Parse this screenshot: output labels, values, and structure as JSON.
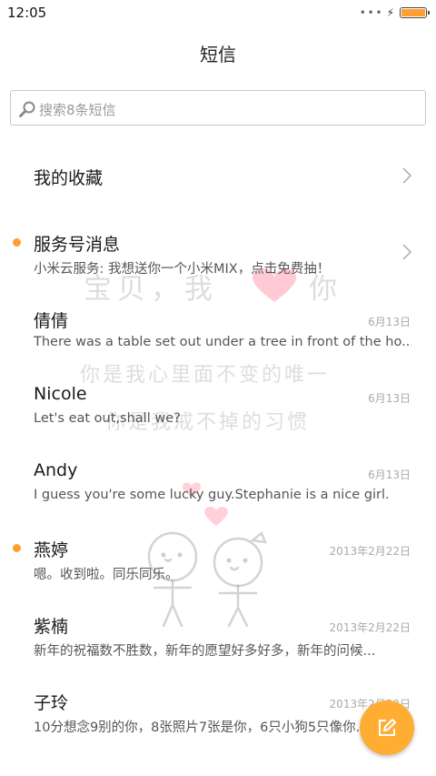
{
  "status_bar": {
    "time": "12:05",
    "battery_level": 1.0,
    "battery_color": "#ff9f2d"
  },
  "header": {
    "title": "短信"
  },
  "search": {
    "placeholder": "搜索8条短信"
  },
  "accent_color": "#ff9f2d",
  "items": [
    {
      "title": "我的收藏",
      "subtitle": "",
      "date": "",
      "unread": false,
      "has_chevron": true
    },
    {
      "title": "服务号消息",
      "subtitle": "小米云服务: 我想送你一个小米MIX，点击免费抽！",
      "date": "",
      "unread": true,
      "has_chevron": true
    },
    {
      "title": "倩倩",
      "subtitle": "There was a table set out under a tree in front of the ho...",
      "date": "6月13日",
      "unread": false,
      "has_chevron": false
    },
    {
      "title": "Nicole",
      "subtitle": "Let's eat out,shall we?",
      "date": "6月13日",
      "unread": false,
      "has_chevron": false
    },
    {
      "title": "Andy",
      "subtitle": "I guess you're some lucky guy.Stephanie is a nice girl.",
      "date": "6月13日",
      "unread": false,
      "has_chevron": false
    },
    {
      "title": "燕婷",
      "subtitle": "嗯。收到啦。同乐同乐。",
      "date": "2013年2月22日",
      "unread": true,
      "has_chevron": false
    },
    {
      "title": "紫楠",
      "subtitle": "新年的祝福数不胜数，新年的愿望好多好多，新年的问候...",
      "date": "2013年2月22日",
      "unread": false,
      "has_chevron": false
    },
    {
      "title": "子玲",
      "subtitle": "10分想念9别的你，8张照片7张是你，6只小狗5只像你...",
      "date": "2013年2月22日",
      "unread": false,
      "has_chevron": false
    }
  ],
  "watermark": {
    "line1": "宝贝，我",
    "line1_end": "你",
    "line2": "你是我心里面不变的唯一",
    "line3": "你是我戒不掉的习惯"
  }
}
